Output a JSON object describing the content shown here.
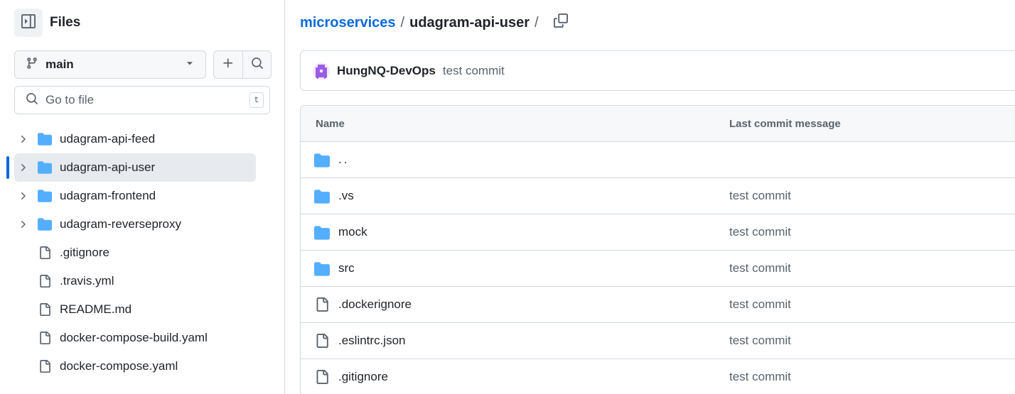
{
  "sidebar": {
    "title": "Files",
    "branch": "main",
    "search_placeholder": "Go to file",
    "search_shortcut": "t",
    "tree": [
      {
        "label": "udagram-api-feed",
        "type": "folder"
      },
      {
        "label": "udagram-api-user",
        "type": "folder",
        "active": true
      },
      {
        "label": "udagram-frontend",
        "type": "folder"
      },
      {
        "label": "udagram-reverseproxy",
        "type": "folder"
      },
      {
        "label": ".gitignore",
        "type": "file"
      },
      {
        "label": ".travis.yml",
        "type": "file"
      },
      {
        "label": "README.md",
        "type": "file"
      },
      {
        "label": "docker-compose-build.yaml",
        "type": "file"
      },
      {
        "label": "docker-compose.yaml",
        "type": "file"
      }
    ]
  },
  "breadcrumb": {
    "root": "microservices",
    "separator": "/",
    "current": "udagram-api-user"
  },
  "latest_commit": {
    "author": "HungNQ-DevOps",
    "message": "test commit"
  },
  "file_table": {
    "columns": [
      "Name",
      "Last commit message"
    ],
    "rows": [
      {
        "name": "..",
        "type": "folder",
        "message": ""
      },
      {
        "name": ".vs",
        "type": "folder",
        "message": "test commit"
      },
      {
        "name": "mock",
        "type": "folder",
        "message": "test commit"
      },
      {
        "name": "src",
        "type": "folder",
        "message": "test commit"
      },
      {
        "name": ".dockerignore",
        "type": "file",
        "message": "test commit"
      },
      {
        "name": ".eslintrc.json",
        "type": "file",
        "message": "test commit"
      },
      {
        "name": ".gitignore",
        "type": "file",
        "message": "test commit"
      }
    ]
  },
  "colors": {
    "accent": "#0969da",
    "folder": "#54aeff",
    "border": "#d1d9e0",
    "muted": "#59636e"
  },
  "icons": {
    "sidebar_toggle": "sidebar-collapse-icon",
    "branch": "git-branch-icon",
    "caret": "triangle-down-icon",
    "add": "plus-icon",
    "search": "search-icon",
    "copy": "copy-icon",
    "folder": "folder-icon",
    "file": "file-icon",
    "chevron": "chevron-right-icon"
  }
}
